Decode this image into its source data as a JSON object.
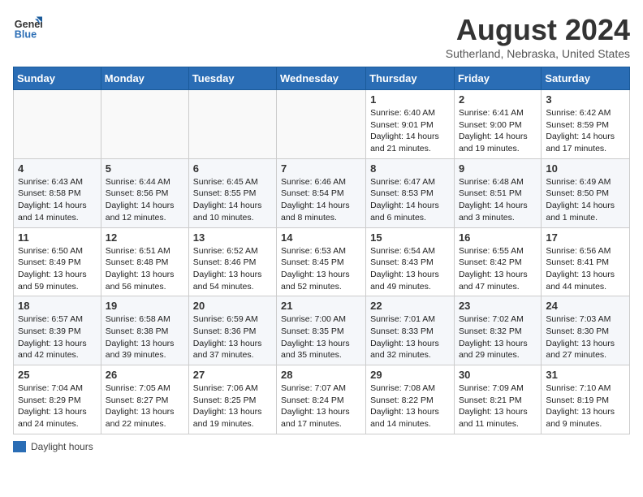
{
  "header": {
    "logo_line1": "General",
    "logo_line2": "Blue",
    "month_year": "August 2024",
    "location": "Sutherland, Nebraska, United States"
  },
  "days_of_week": [
    "Sunday",
    "Monday",
    "Tuesday",
    "Wednesday",
    "Thursday",
    "Friday",
    "Saturday"
  ],
  "legend": {
    "label": "Daylight hours"
  },
  "weeks": [
    [
      {
        "day": "",
        "content": ""
      },
      {
        "day": "",
        "content": ""
      },
      {
        "day": "",
        "content": ""
      },
      {
        "day": "",
        "content": ""
      },
      {
        "day": "1",
        "content": "Sunrise: 6:40 AM\nSunset: 9:01 PM\nDaylight: 14 hours and 21 minutes."
      },
      {
        "day": "2",
        "content": "Sunrise: 6:41 AM\nSunset: 9:00 PM\nDaylight: 14 hours and 19 minutes."
      },
      {
        "day": "3",
        "content": "Sunrise: 6:42 AM\nSunset: 8:59 PM\nDaylight: 14 hours and 17 minutes."
      }
    ],
    [
      {
        "day": "4",
        "content": "Sunrise: 6:43 AM\nSunset: 8:58 PM\nDaylight: 14 hours and 14 minutes."
      },
      {
        "day": "5",
        "content": "Sunrise: 6:44 AM\nSunset: 8:56 PM\nDaylight: 14 hours and 12 minutes."
      },
      {
        "day": "6",
        "content": "Sunrise: 6:45 AM\nSunset: 8:55 PM\nDaylight: 14 hours and 10 minutes."
      },
      {
        "day": "7",
        "content": "Sunrise: 6:46 AM\nSunset: 8:54 PM\nDaylight: 14 hours and 8 minutes."
      },
      {
        "day": "8",
        "content": "Sunrise: 6:47 AM\nSunset: 8:53 PM\nDaylight: 14 hours and 6 minutes."
      },
      {
        "day": "9",
        "content": "Sunrise: 6:48 AM\nSunset: 8:51 PM\nDaylight: 14 hours and 3 minutes."
      },
      {
        "day": "10",
        "content": "Sunrise: 6:49 AM\nSunset: 8:50 PM\nDaylight: 14 hours and 1 minute."
      }
    ],
    [
      {
        "day": "11",
        "content": "Sunrise: 6:50 AM\nSunset: 8:49 PM\nDaylight: 13 hours and 59 minutes."
      },
      {
        "day": "12",
        "content": "Sunrise: 6:51 AM\nSunset: 8:48 PM\nDaylight: 13 hours and 56 minutes."
      },
      {
        "day": "13",
        "content": "Sunrise: 6:52 AM\nSunset: 8:46 PM\nDaylight: 13 hours and 54 minutes."
      },
      {
        "day": "14",
        "content": "Sunrise: 6:53 AM\nSunset: 8:45 PM\nDaylight: 13 hours and 52 minutes."
      },
      {
        "day": "15",
        "content": "Sunrise: 6:54 AM\nSunset: 8:43 PM\nDaylight: 13 hours and 49 minutes."
      },
      {
        "day": "16",
        "content": "Sunrise: 6:55 AM\nSunset: 8:42 PM\nDaylight: 13 hours and 47 minutes."
      },
      {
        "day": "17",
        "content": "Sunrise: 6:56 AM\nSunset: 8:41 PM\nDaylight: 13 hours and 44 minutes."
      }
    ],
    [
      {
        "day": "18",
        "content": "Sunrise: 6:57 AM\nSunset: 8:39 PM\nDaylight: 13 hours and 42 minutes."
      },
      {
        "day": "19",
        "content": "Sunrise: 6:58 AM\nSunset: 8:38 PM\nDaylight: 13 hours and 39 minutes."
      },
      {
        "day": "20",
        "content": "Sunrise: 6:59 AM\nSunset: 8:36 PM\nDaylight: 13 hours and 37 minutes."
      },
      {
        "day": "21",
        "content": "Sunrise: 7:00 AM\nSunset: 8:35 PM\nDaylight: 13 hours and 35 minutes."
      },
      {
        "day": "22",
        "content": "Sunrise: 7:01 AM\nSunset: 8:33 PM\nDaylight: 13 hours and 32 minutes."
      },
      {
        "day": "23",
        "content": "Sunrise: 7:02 AM\nSunset: 8:32 PM\nDaylight: 13 hours and 29 minutes."
      },
      {
        "day": "24",
        "content": "Sunrise: 7:03 AM\nSunset: 8:30 PM\nDaylight: 13 hours and 27 minutes."
      }
    ],
    [
      {
        "day": "25",
        "content": "Sunrise: 7:04 AM\nSunset: 8:29 PM\nDaylight: 13 hours and 24 minutes."
      },
      {
        "day": "26",
        "content": "Sunrise: 7:05 AM\nSunset: 8:27 PM\nDaylight: 13 hours and 22 minutes."
      },
      {
        "day": "27",
        "content": "Sunrise: 7:06 AM\nSunset: 8:25 PM\nDaylight: 13 hours and 19 minutes."
      },
      {
        "day": "28",
        "content": "Sunrise: 7:07 AM\nSunset: 8:24 PM\nDaylight: 13 hours and 17 minutes."
      },
      {
        "day": "29",
        "content": "Sunrise: 7:08 AM\nSunset: 8:22 PM\nDaylight: 13 hours and 14 minutes."
      },
      {
        "day": "30",
        "content": "Sunrise: 7:09 AM\nSunset: 8:21 PM\nDaylight: 13 hours and 11 minutes."
      },
      {
        "day": "31",
        "content": "Sunrise: 7:10 AM\nSunset: 8:19 PM\nDaylight: 13 hours and 9 minutes."
      }
    ]
  ]
}
